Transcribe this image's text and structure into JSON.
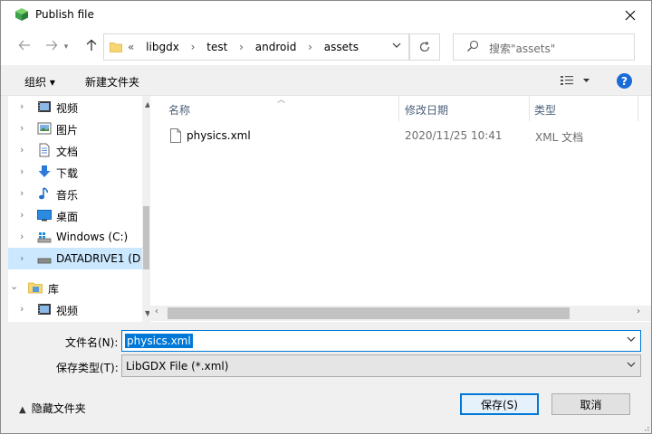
{
  "window": {
    "title": "Publish file",
    "close_icon": "close-icon",
    "app_icon": "green-cube-icon"
  },
  "navigation": {
    "back_icon": "arrow-left-icon",
    "forward_icon": "arrow-right-icon",
    "up_icon": "arrow-up-icon",
    "address_prefix": "«",
    "breadcrumb": [
      "libgdx",
      "test",
      "android",
      "assets"
    ],
    "refresh_icon": "refresh-icon",
    "search_placeholder": "搜索\"assets\""
  },
  "toolbar": {
    "organize_label": "组织 ▾",
    "new_folder_label": "新建文件夹",
    "view_icon": "view-list-icon",
    "help_label": "?"
  },
  "sidebar": {
    "items": [
      {
        "label": "视频",
        "icon": "video-icon",
        "expanded": false
      },
      {
        "label": "图片",
        "icon": "picture-icon",
        "expanded": false
      },
      {
        "label": "文档",
        "icon": "document-icon",
        "expanded": false
      },
      {
        "label": "下载",
        "icon": "download-icon",
        "expanded": false
      },
      {
        "label": "音乐",
        "icon": "music-icon",
        "expanded": false
      },
      {
        "label": "桌面",
        "icon": "desktop-icon",
        "expanded": false
      },
      {
        "label": "Windows  (C:)",
        "icon": "windows-drive-icon",
        "expanded": false
      },
      {
        "label": "DATADRIVE1 (D",
        "icon": "drive-icon",
        "expanded": false,
        "selected": true
      },
      {
        "label": "库",
        "icon": "library-icon",
        "expanded": true
      },
      {
        "label": "视频",
        "icon": "video-icon",
        "expanded": false
      }
    ]
  },
  "file_list": {
    "columns": [
      "名称",
      "修改日期",
      "类型"
    ],
    "rows": [
      {
        "name": "physics.xml",
        "modified": "2020/11/25 10:41",
        "type": "XML 文档",
        "icon": "file-icon"
      }
    ]
  },
  "form": {
    "filename_label": "文件名(N):",
    "filename_value": "physics.xml",
    "filetype_label": "保存类型(T):",
    "filetype_value": "LibGDX File (*.xml)"
  },
  "footer": {
    "hide_folders_label": "隐藏文件夹",
    "save_label": "保存(S)",
    "cancel_label": "取消"
  },
  "colors": {
    "accent": "#0078d7",
    "selection": "#cce8ff",
    "header_text": "#4c607a"
  }
}
